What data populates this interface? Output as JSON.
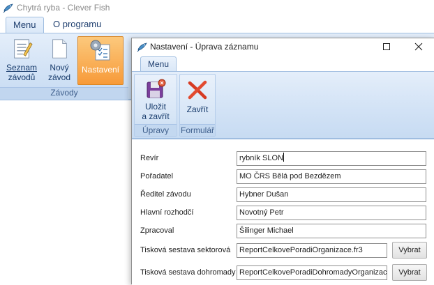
{
  "main_window": {
    "title": "Chytrá ryba - Clever Fish",
    "tabs": [
      {
        "label": "Menu",
        "active": true
      },
      {
        "label": "O programu",
        "active": false
      }
    ],
    "ribbon": {
      "buttons": [
        {
          "line1": "Seznam",
          "line2": "závodů",
          "icon": "list-document-icon"
        },
        {
          "line1": "Nový",
          "line2": "závod",
          "icon": "new-document-icon"
        },
        {
          "line1": "Nastavení",
          "line2": "",
          "icon": "settings-gear-icon",
          "active": true
        }
      ],
      "group_label": "Závody"
    }
  },
  "dialog": {
    "title": "Nastavení - Úprava záznamu",
    "tabs": [
      {
        "label": "Menu"
      }
    ],
    "ribbon": {
      "groups": [
        {
          "label": "Úpravy",
          "buttons": [
            {
              "line1": "Uložit",
              "line2": "a zavřít",
              "icon": "save-disk-icon"
            }
          ]
        },
        {
          "label": "Formulář",
          "buttons": [
            {
              "line1": "Zavřít",
              "line2": "",
              "icon": "close-x-icon"
            }
          ]
        }
      ]
    },
    "form": {
      "fields": [
        {
          "label": "Revír",
          "value": "rybník SLON"
        },
        {
          "label": "Pořadatel",
          "value": "MO ČRS Bělá pod Bezdězem"
        },
        {
          "label": "Ředitel závodu",
          "value": "Hybner Dušan"
        },
        {
          "label": "Hlavní rozhodčí",
          "value": "Novotný Petr"
        },
        {
          "label": "Zpracoval",
          "value": "Šilinger Michael"
        },
        {
          "label": "Tisková sestava sektorová",
          "value": "ReportCelkovePoradiOrganizace.fr3",
          "button": "Vybrat"
        },
        {
          "label": "Tisková sestava dohromady",
          "value": "ReportCelkovePoradiDohromadyOrganizace.",
          "button": "Vybrat"
        }
      ]
    }
  },
  "colors": {
    "ribbon_top": "#e4eefa",
    "ribbon_bottom": "#c7dbf2",
    "active_button": "#f79a39",
    "tab_text": "#1e3e6e"
  }
}
